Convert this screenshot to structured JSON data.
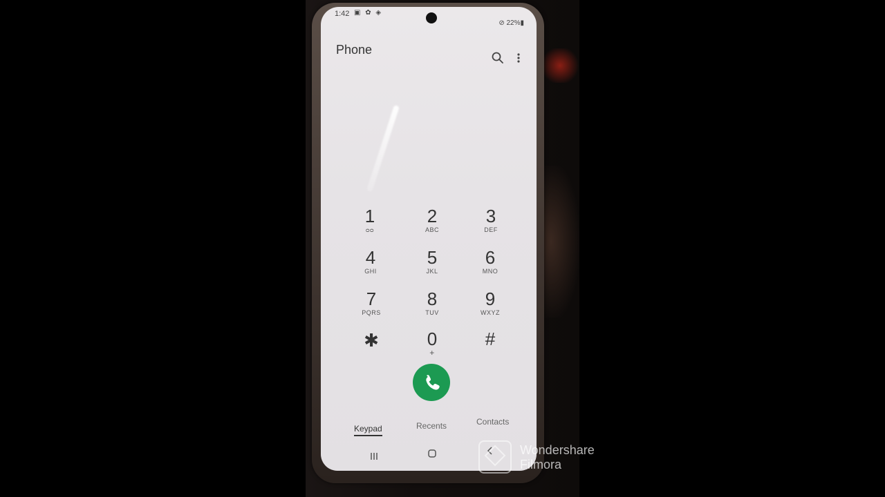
{
  "status_bar": {
    "time": "1:42",
    "left_icons": "▣ ✿ ◈",
    "battery": "⊘ 22%▮"
  },
  "header": {
    "title": "Phone"
  },
  "keypad": {
    "keys": [
      {
        "digit": "1",
        "letters": "ᴑᴑ"
      },
      {
        "digit": "2",
        "letters": "ABC"
      },
      {
        "digit": "3",
        "letters": "DEF"
      },
      {
        "digit": "4",
        "letters": "GHI"
      },
      {
        "digit": "5",
        "letters": "JKL"
      },
      {
        "digit": "6",
        "letters": "MNO"
      },
      {
        "digit": "7",
        "letters": "PQRS"
      },
      {
        "digit": "8",
        "letters": "TUV"
      },
      {
        "digit": "9",
        "letters": "WXYZ"
      },
      {
        "digit": "✱",
        "letters": ""
      },
      {
        "digit": "0",
        "letters": "+"
      },
      {
        "digit": "#",
        "letters": ""
      }
    ]
  },
  "tabs": {
    "keypad": "Keypad",
    "recents": "Recents",
    "contacts": "Contacts"
  },
  "colors": {
    "call_button": "#1c9a52",
    "screen_bg": "#e8e5e8"
  },
  "icons": {
    "search": "search-icon",
    "more": "more-vert-icon",
    "call": "phone-icon",
    "recents_nav": "recents-nav-icon",
    "home_nav": "home-nav-icon",
    "back_nav": "back-nav-icon"
  },
  "watermark": {
    "line1": "Wondershare",
    "line2": "Filmora"
  }
}
